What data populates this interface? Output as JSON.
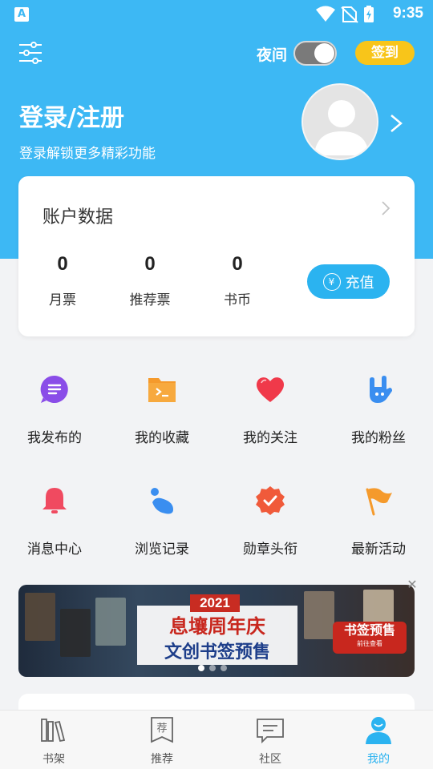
{
  "status_bar": {
    "app_icon": "A",
    "time": "9:35"
  },
  "header": {
    "night_mode_label": "夜间",
    "night_mode_on": true,
    "signin_label": "签到",
    "login_title": "登录/注册",
    "login_subtitle": "登录解锁更多精彩功能"
  },
  "account": {
    "title": "账户数据",
    "stats": [
      {
        "value": "0",
        "label": "月票"
      },
      {
        "value": "0",
        "label": "推荐票"
      },
      {
        "value": "0",
        "label": "书币"
      }
    ],
    "recharge_label": "充值",
    "recharge_icon_glyph": "¥"
  },
  "grid": [
    {
      "label": "我发布的",
      "icon": "publish-icon",
      "color": "#8a4de8"
    },
    {
      "label": "我的收藏",
      "icon": "folder-icon",
      "color": "#f59a2c"
    },
    {
      "label": "我的关注",
      "icon": "heart-icon",
      "color": "#f0394a"
    },
    {
      "label": "我的粉丝",
      "icon": "hand-icon",
      "color": "#3a8ef0"
    },
    {
      "label": "消息中心",
      "icon": "bell-icon",
      "color": "#f04a60"
    },
    {
      "label": "浏览记录",
      "icon": "history-icon",
      "color": "#3a8ef0"
    },
    {
      "label": "勋章头衔",
      "icon": "medal-icon",
      "color": "#f05a3a"
    },
    {
      "label": "最新活动",
      "icon": "flag-icon",
      "color": "#f59a2c"
    }
  ],
  "banner": {
    "year": "2021",
    "line1": "息壤周年庆",
    "line2": "文创书签预售",
    "badge_title": "书签预售",
    "badge_sub": "前往查看",
    "close_glyph": "✕",
    "slide_count": 3,
    "active_slide": 1
  },
  "bottom_nav": [
    {
      "label": "书架",
      "icon": "bookshelf-icon",
      "active": false
    },
    {
      "label": "推荐",
      "icon": "recommend-icon",
      "active": false,
      "icon_glyph": "荐"
    },
    {
      "label": "社区",
      "icon": "community-icon",
      "active": false
    },
    {
      "label": "我的",
      "icon": "profile-icon",
      "active": true
    }
  ],
  "colors": {
    "header_blue": "#3db8f4",
    "accent_blue": "#2bb3f0",
    "signin_yellow": "#f8c51a"
  }
}
